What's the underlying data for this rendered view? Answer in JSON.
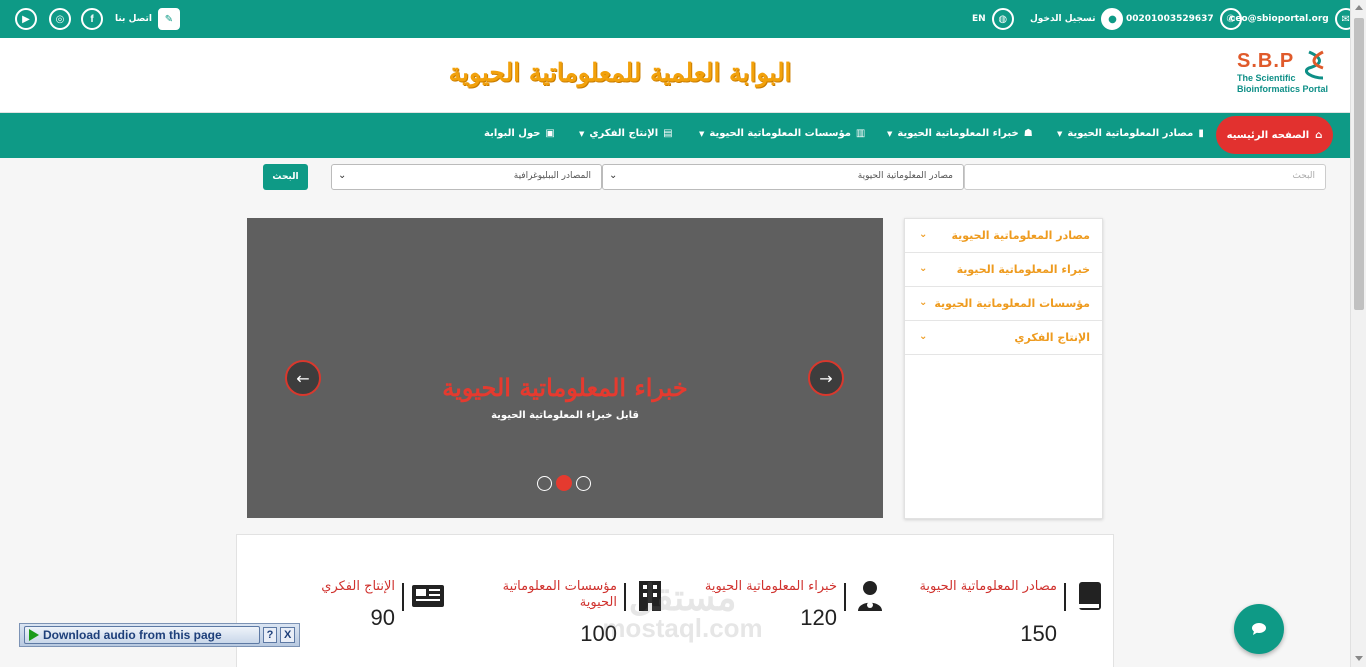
{
  "topbar": {
    "email": "ceo@sbioportal.org",
    "phone": "0020100352963‎7",
    "login": "تسجيل الدخول",
    "language": "EN",
    "contact": "اتصل بنا"
  },
  "header": {
    "site_title": "البوابة العلمية للمعلوماتية الحيوية",
    "logo_letters": "S.B.P",
    "logo_line1": "The Scientific",
    "logo_line2": "Bioinformatics Portal"
  },
  "nav": {
    "home": "الصفحه الرئيسيه",
    "items": [
      {
        "label": "مصادر المعلوماتية الحيوية",
        "icon": "book-icon"
      },
      {
        "label": "خبراء المعلوماتية الحيوية",
        "icon": "users-icon"
      },
      {
        "label": "مؤسسات المعلوماتية الحيوية",
        "icon": "building-icon"
      },
      {
        "label": "الإنتاج الفكري",
        "icon": "newspaper-icon"
      },
      {
        "label": "حول البوابة",
        "icon": "id-card-icon"
      }
    ]
  },
  "search": {
    "placeholder": "البحث",
    "select1": "مصادر المعلوماتية الحيوية",
    "select2": "المصادر الببليوغرافية",
    "button": "البحث"
  },
  "sidebar": {
    "items": [
      {
        "label": "مصادر المعلوماتية الحيوية"
      },
      {
        "label": "خبراء المعلوماتية الحيوية"
      },
      {
        "label": "مؤسسات المعلوماتية الحيوية"
      },
      {
        "label": "الإنتاج الفكري"
      }
    ]
  },
  "slider": {
    "title": "خبراء المعلوماتية الحيوية",
    "subtitle": "قابل خبراء المعلوماتية الحيوية",
    "active_index": 1,
    "slide_count": 3
  },
  "stats": [
    {
      "label": "مصادر المعلوماتية الحيوية",
      "value": "150",
      "icon": "book-icon"
    },
    {
      "label": "خبراء المعلوماتية الحيوية",
      "value": "120",
      "icon": "user-doctor-icon"
    },
    {
      "label": "مؤسسات المعلوماتية الحيوية",
      "value": "100",
      "icon": "building-icon"
    },
    {
      "label": "الإنتاج الفكري",
      "value": "90",
      "icon": "newspaper-icon"
    }
  ],
  "watermark": {
    "arabic": "مستقل",
    "latin": "mostaql.com"
  },
  "audio_bar": {
    "label": "Download audio from this page",
    "help": "?",
    "close": "X"
  },
  "colors": {
    "primary": "#0e9a86",
    "accent": "#e2312f",
    "title": "#f2a10b",
    "sidebar_text": "#ee9b1f"
  }
}
